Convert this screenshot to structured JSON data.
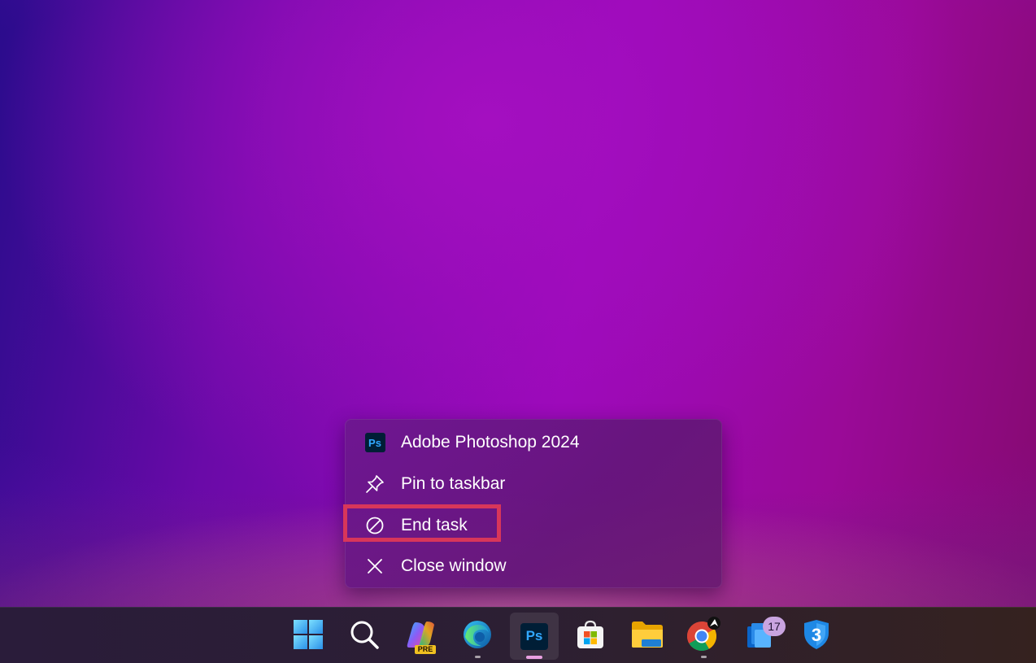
{
  "context_menu": {
    "items": [
      {
        "label": "Adobe Photoshop 2024",
        "icon": "photoshop-icon",
        "icon_text": "Ps"
      },
      {
        "label": "Pin to taskbar",
        "icon": "pin-icon"
      },
      {
        "label": "End task",
        "icon": "prohibited-icon",
        "highlighted": true
      },
      {
        "label": "Close window",
        "icon": "close-icon"
      }
    ]
  },
  "taskbar": {
    "items": [
      {
        "name": "start-button",
        "icon": "windows-logo-icon"
      },
      {
        "name": "search-button",
        "icon": "search-icon"
      },
      {
        "name": "copilot-button",
        "icon": "copilot-icon",
        "tag": "PRE"
      },
      {
        "name": "edge-button",
        "icon": "edge-icon",
        "running": true
      },
      {
        "name": "photoshop-button",
        "icon": "photoshop-icon",
        "icon_text": "Ps",
        "active": true
      },
      {
        "name": "store-button",
        "icon": "store-icon"
      },
      {
        "name": "file-explorer-button",
        "icon": "folder-icon"
      },
      {
        "name": "chrome-button",
        "icon": "chrome-icon",
        "running": true
      },
      {
        "name": "sticky-app-button",
        "icon": "stack-app-icon",
        "badge": "17"
      },
      {
        "name": "security-app-button",
        "icon": "shield-3-icon",
        "icon_text": "3"
      }
    ]
  },
  "colors": {
    "highlight_box": "#d8365a",
    "photoshop_bg": "#001e36",
    "photoshop_fg": "#31a8ff"
  }
}
